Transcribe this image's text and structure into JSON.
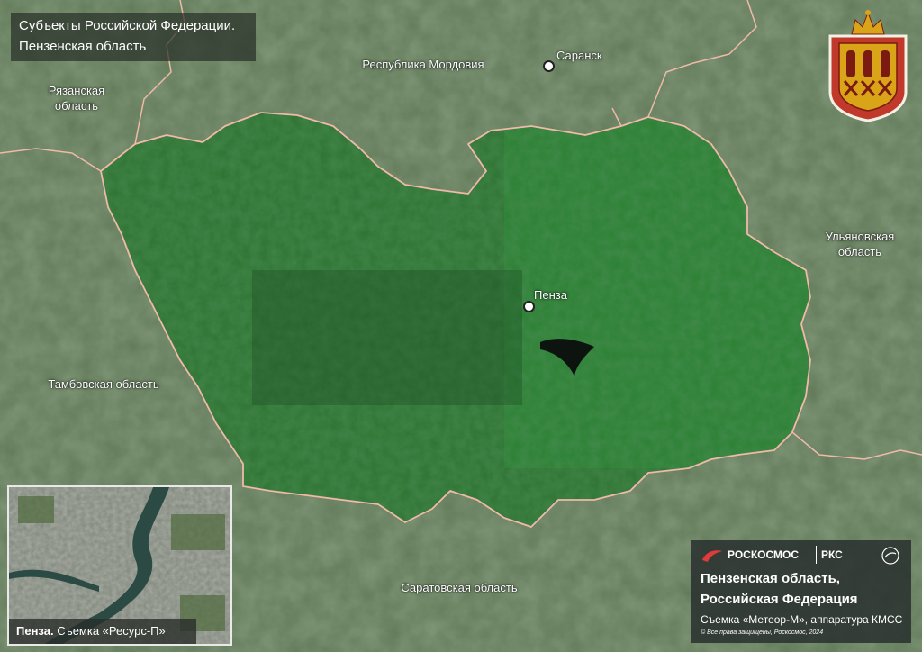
{
  "header": {
    "line1": "Субъекты Российской Федерации.",
    "line2": "Пензенская область"
  },
  "labels": {
    "ryazan": "Рязанская\nобласть",
    "mordovia": "Республика Мордовия",
    "saransk": "Саранск",
    "penza": "Пенза",
    "ulyanovsk": "Ульяновская\nобласть",
    "tambov": "Тамбовская область",
    "saratov": "Саратовская область"
  },
  "inset": {
    "city": "Пенза.",
    "caption": "Съемка «Ресурс-П»"
  },
  "info": {
    "logo_roscosmos": "РОСКОСМОС",
    "logo_rks": "РКС",
    "line1": "Пензенская область,",
    "line2": "Российская Федерация",
    "line3": "Съемка «Метеор-М», аппаратура КМСС",
    "copyright": "© Все права защищены, Роскосмос, 2024"
  },
  "colors": {
    "region_green": "#2f7a34",
    "border_pink": "#f0b9a8",
    "outer_terrain": "#5e7a56"
  },
  "icons": [
    "coat-of-arms-icon",
    "roscosmos-logo-icon",
    "rks-logo-icon",
    "roscosmos-emblem-icon"
  ]
}
